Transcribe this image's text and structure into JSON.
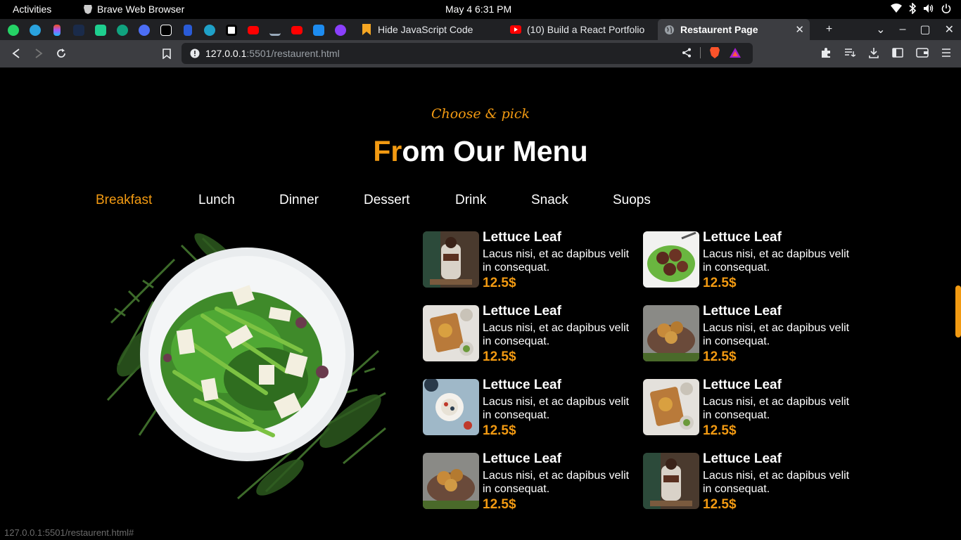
{
  "system": {
    "activities": "Activities",
    "app_name": "Brave Web Browser",
    "clock": "May 4   6:31 PM"
  },
  "tabs": [
    {
      "title": "Hide JavaScript Code",
      "icon": "bookmark-icon"
    },
    {
      "title": "(10) Build a React Portfolio",
      "icon": "youtube-icon"
    },
    {
      "title": "Restaurent Page",
      "icon": "globe-icon",
      "active": true
    }
  ],
  "pinned_tabs": [
    "whatsapp",
    "telegram",
    "figma",
    "app",
    "app",
    "chatgpt",
    "app",
    "notion",
    "docs",
    "app",
    "app",
    "youtube",
    "app",
    "youtube",
    "app",
    "app"
  ],
  "address_bar": {
    "host": "127.0.0.1",
    "path": ":5501/restaurent.html"
  },
  "page": {
    "subtitle": "Choose & pick",
    "heading_highlight": "Fr",
    "heading_rest": "om Our Menu",
    "categories": [
      "Breakfast",
      "Lunch",
      "Dinner",
      "Dessert",
      "Drink",
      "Snack",
      "Suops"
    ],
    "active_category": "Breakfast",
    "menu_items": [
      {
        "name": "Lettuce Leaf",
        "description": "Lacus nisi, et ac dapibus velit in consequat.",
        "price": "12.5$"
      },
      {
        "name": "Lettuce Leaf",
        "description": "Lacus nisi, et ac dapibus velit in consequat.",
        "price": "12.5$"
      },
      {
        "name": "Lettuce Leaf",
        "description": "Lacus nisi, et ac dapibus velit in consequat.",
        "price": "12.5$"
      },
      {
        "name": "Lettuce Leaf",
        "description": "Lacus nisi, et ac dapibus velit in consequat.",
        "price": "12.5$"
      },
      {
        "name": "Lettuce Leaf",
        "description": "Lacus nisi, et ac dapibus velit in consequat.",
        "price": "12.5$"
      },
      {
        "name": "Lettuce Leaf",
        "description": "Lacus nisi, et ac dapibus velit in consequat.",
        "price": "12.5$"
      },
      {
        "name": "Lettuce Leaf",
        "description": "Lacus nisi, et ac dapibus velit in consequat.",
        "price": "12.5$"
      },
      {
        "name": "Lettuce Leaf",
        "description": "Lacus nisi, et ac dapibus velit in consequat.",
        "price": "12.5$"
      }
    ]
  },
  "status_url": "127.0.0.1:5501/restaurent.html#",
  "colors": {
    "accent": "#f29a12",
    "background": "#000000",
    "toolbar": "#3c3d41",
    "tabstrip": "#202124"
  }
}
